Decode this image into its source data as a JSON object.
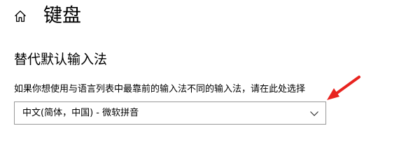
{
  "header": {
    "home_icon": "home-icon",
    "title": "键盘"
  },
  "section": {
    "title": "替代默认输入法",
    "description": "如果你想使用与语言列表中最靠前的输入法不同的输入法，请在此处选择"
  },
  "input_method_select": {
    "selected": "中文(简体，中国) - 微软拼音",
    "icon": "chevron-down-icon"
  },
  "annotation": {
    "icon": "red-arrow-icon",
    "color": "#e8231f"
  }
}
